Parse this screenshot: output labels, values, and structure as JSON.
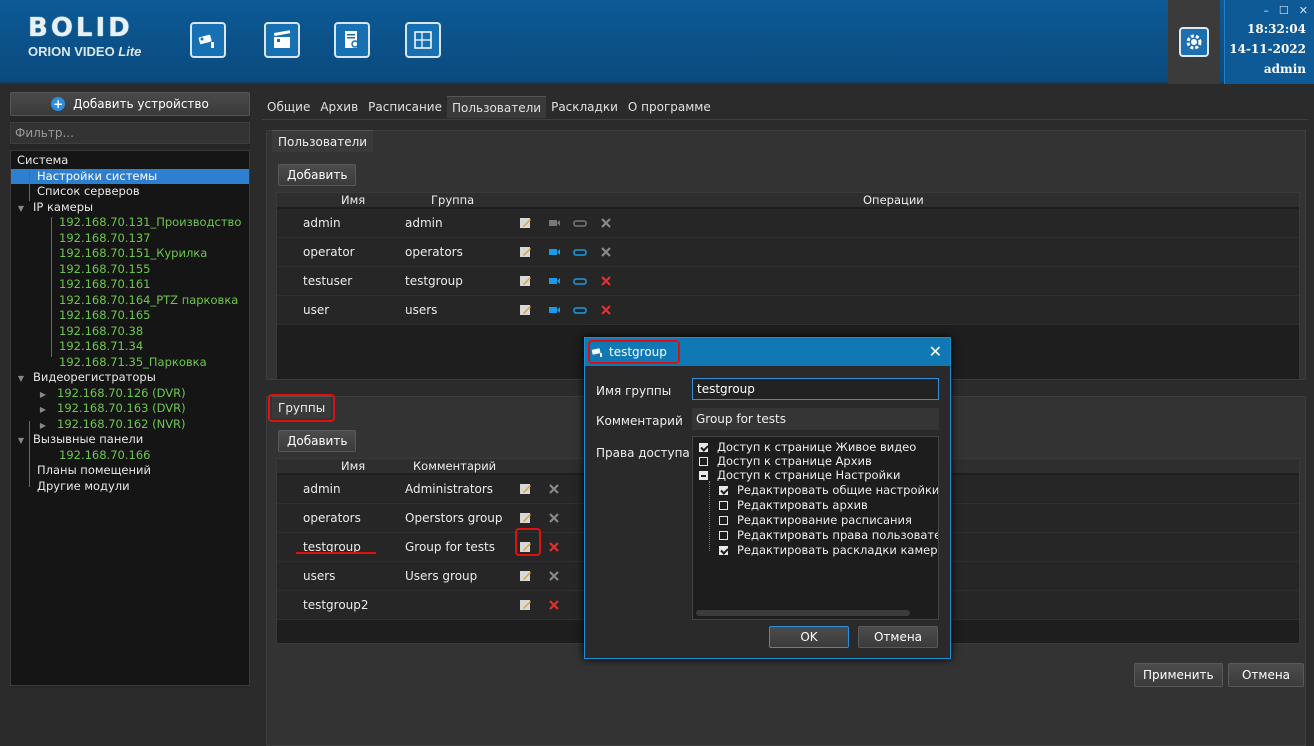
{
  "logo": {
    "brand": "BOLID",
    "sub_main": "ORION VIDEO ",
    "sub_lite": "Lite"
  },
  "nav_icons": [
    "camera-icon",
    "clapperboard-icon",
    "report-icon",
    "layout-icon"
  ],
  "status": {
    "time": "18:32:04",
    "date": "14-11-2022",
    "user": "admin",
    "min": "–",
    "max": "☐",
    "close": "✕"
  },
  "left": {
    "add_device": "Добавить устройство",
    "filter_placeholder": "Фильтр...",
    "tree": [
      {
        "label": "Система"
      },
      {
        "label": "Настройки системы"
      },
      {
        "label": "Список серверов"
      },
      {
        "label": "IP камеры"
      },
      {
        "label": "192.168.70.131_Производство"
      },
      {
        "label": "192.168.70.137"
      },
      {
        "label": "192.168.70.151_Курилка"
      },
      {
        "label": "192.168.70.155"
      },
      {
        "label": "192.168.70.161"
      },
      {
        "label": "192.168.70.164_PTZ парковка"
      },
      {
        "label": "192.168.70.165"
      },
      {
        "label": "192.168.70.38"
      },
      {
        "label": "192.168.71.34"
      },
      {
        "label": "192.168.71.35_Парковка"
      },
      {
        "label": "Видеорегистраторы"
      },
      {
        "label": "192.168.70.126 (DVR)"
      },
      {
        "label": "192.168.70.163 (DVR)"
      },
      {
        "label": "192.168.70.162 (NVR)"
      },
      {
        "label": "Вызывные панели"
      },
      {
        "label": "192.168.70.166"
      },
      {
        "label": "Планы помещений"
      },
      {
        "label": "Другие модули"
      }
    ]
  },
  "tabs": [
    "Общие",
    "Архив",
    "Расписание",
    "Пользователи",
    "Раскладки",
    "О программе"
  ],
  "users": {
    "title": "Пользователи",
    "add": "Добавить",
    "headers": {
      "name": "Имя",
      "group": "Группа",
      "ops": "Операции"
    },
    "rows": [
      {
        "name": "admin",
        "group": "admin"
      },
      {
        "name": "operator",
        "group": "operators"
      },
      {
        "name": "testuser",
        "group": "testgroup"
      },
      {
        "name": "user",
        "group": "users"
      }
    ]
  },
  "groups": {
    "title": "Группы",
    "add": "Добавить",
    "headers": {
      "name": "Имя",
      "comment": "Комментарий"
    },
    "rows": [
      {
        "name": "admin",
        "comment": "Administrators"
      },
      {
        "name": "operators",
        "comment": "Operstors group"
      },
      {
        "name": "testgroup",
        "comment": "Group for tests"
      },
      {
        "name": "users",
        "comment": "Users group"
      },
      {
        "name": "testgroup2",
        "comment": ""
      }
    ]
  },
  "footer": {
    "apply": "Применить",
    "cancel": "Отмена"
  },
  "dialog": {
    "title": "testgroup",
    "name_label": "Имя группы",
    "name_value": "testgroup",
    "comment_label": "Комментарий",
    "comment_value": "Group for tests",
    "rights_label": "Права доступа",
    "rights": [
      "Доступ к странице Живое видео",
      "Доступ к странице Архив",
      "Доступ к странице Настройки",
      "Редактировать общие настройки",
      "Редактировать архив",
      "Редактирование расписания",
      "Редактировать права пользовате",
      "Редактировать раскладки камер"
    ],
    "ok": "OK",
    "cancel": "Отмена"
  },
  "colors": {
    "accent": "#1178b6",
    "tree_green": "#6dc84a",
    "highlight": "#dd1111"
  }
}
